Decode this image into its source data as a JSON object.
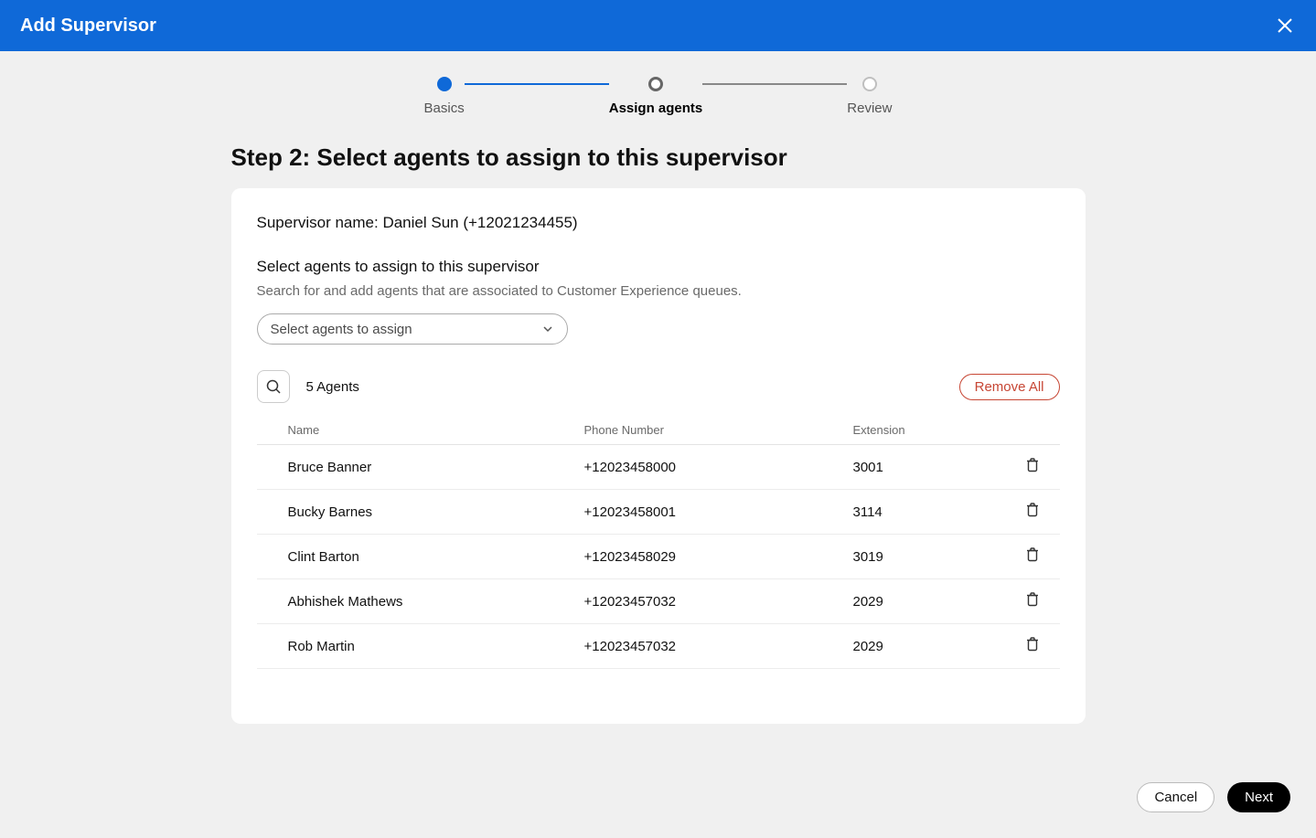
{
  "header": {
    "title": "Add Supervisor"
  },
  "stepper": {
    "steps": [
      {
        "label": "Basics"
      },
      {
        "label": "Assign agents"
      },
      {
        "label": "Review"
      }
    ]
  },
  "page": {
    "title": "Step 2: Select agents to assign to this supervisor"
  },
  "supervisor": {
    "label": "Supervisor name: Daniel Sun (+12021234455)"
  },
  "section": {
    "subtitle": "Select agents to assign to this supervisor",
    "help": "Search for and add agents that are associated to Customer Experience queues."
  },
  "select": {
    "placeholder": "Select agents to assign"
  },
  "toolbar": {
    "count": "5 Agents",
    "remove_all": "Remove All"
  },
  "table": {
    "headers": {
      "name": "Name",
      "phone": "Phone Number",
      "ext": "Extension"
    },
    "rows": [
      {
        "name": "Bruce Banner",
        "phone": "+12023458000",
        "ext": "3001"
      },
      {
        "name": "Bucky Barnes",
        "phone": "+12023458001",
        "ext": "3114"
      },
      {
        "name": "Clint Barton",
        "phone": "+12023458029",
        "ext": "3019"
      },
      {
        "name": "Abhishek Mathews",
        "phone": "+12023457032",
        "ext": "2029"
      },
      {
        "name": "Rob Martin",
        "phone": "+12023457032",
        "ext": "2029"
      }
    ]
  },
  "footer": {
    "cancel": "Cancel",
    "next": "Next"
  }
}
